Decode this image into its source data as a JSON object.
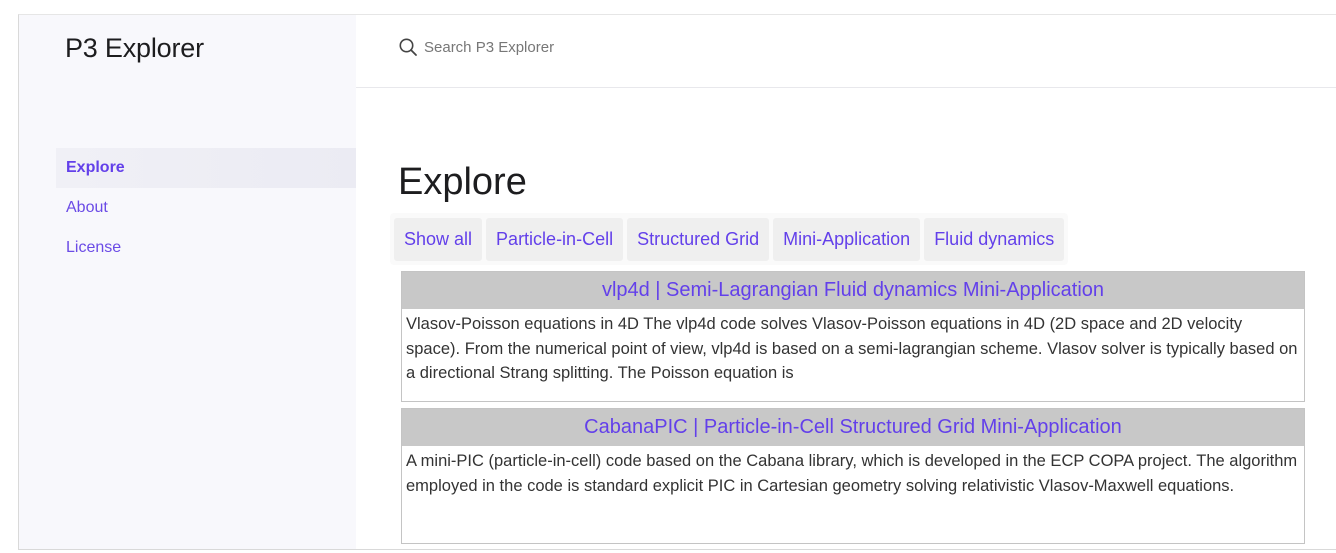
{
  "app": {
    "title": "P3 Explorer"
  },
  "search": {
    "placeholder": "Search P3 Explorer"
  },
  "sidebar": {
    "items": [
      {
        "label": "Explore",
        "active": true
      },
      {
        "label": "About",
        "active": false
      },
      {
        "label": "License",
        "active": false
      }
    ]
  },
  "main": {
    "title": "Explore",
    "filters": [
      "Show all",
      "Particle-in-Cell",
      "Structured Grid",
      "Mini-Application",
      "Fluid dynamics"
    ],
    "cards": [
      {
        "title": "vlp4d | Semi-Lagrangian  Fluid dynamics  Mini-Application",
        "description": "Vlasov-Poisson equations in 4D The vlp4d code solves Vlasov-Poisson equations in 4D (2D space and 2D velocity space). From the numerical point of view, vlp4d is based on a semi-lagrangian scheme. Vlasov solver is typically based on a directional Strang splitting. The Poisson equation is"
      },
      {
        "title": "CabanaPIC | Particle-in-Cell  Structured Grid  Mini-Application",
        "description": "A mini-PIC (particle-in-cell) code based on the Cabana library, which is developed in the ECP COPA project. The algorithm employed in the code is standard explicit PIC in Cartesian geometry solving relativistic Vlasov-Maxwell equations."
      }
    ]
  },
  "colors": {
    "accent": "#6340ea",
    "sidebar_bg": "#f8f8fc",
    "card_header_bg": "#c8c8c8"
  }
}
